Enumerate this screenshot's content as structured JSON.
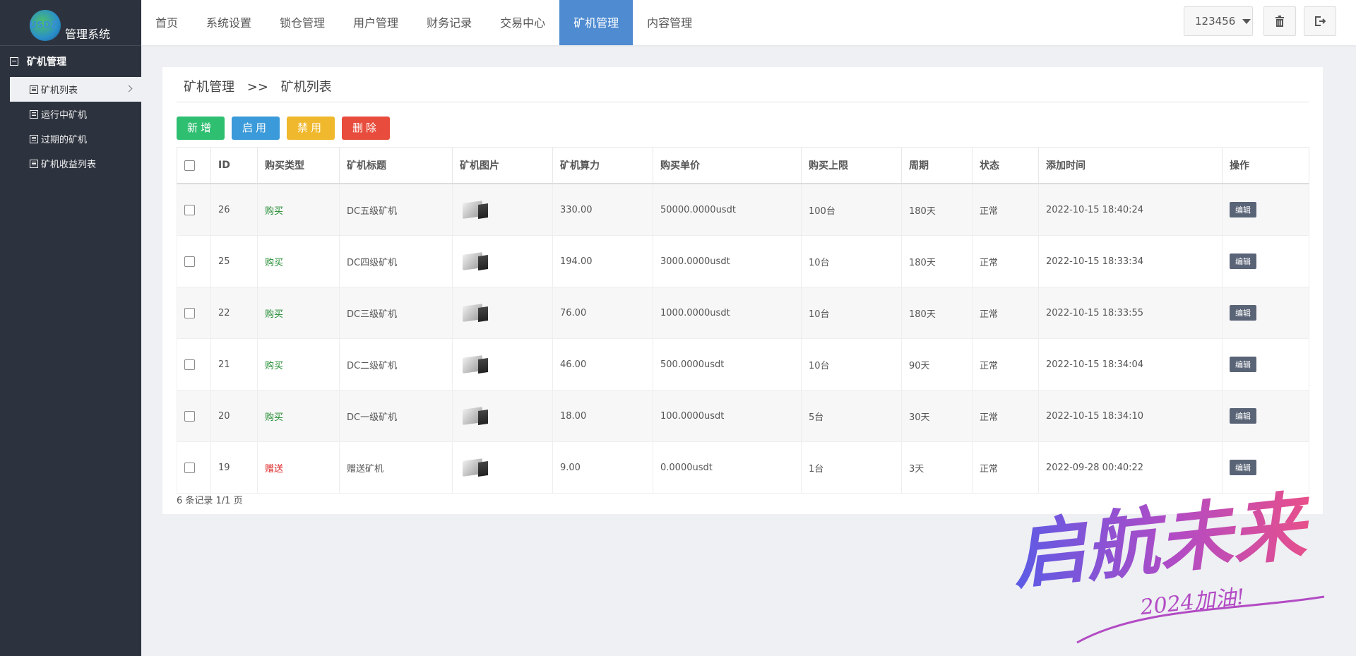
{
  "brand": {
    "logo_abbr": "USDZ",
    "name": "管理系统"
  },
  "sidebar": {
    "group": "矿机管理",
    "items": [
      {
        "label": "矿机列表",
        "active": true
      },
      {
        "label": "运行中矿机"
      },
      {
        "label": "过期的矿机"
      },
      {
        "label": "矿机收益列表"
      }
    ]
  },
  "nav": {
    "items": [
      "首页",
      "系统设置",
      "锁仓管理",
      "用户管理",
      "财务记录",
      "交易中心",
      "矿机管理",
      "内容管理"
    ],
    "active": "矿机管理",
    "user": "123456",
    "icons": [
      "trash-icon",
      "logout-icon"
    ]
  },
  "breadcrumb": {
    "parent": "矿机管理",
    "sep": ">>",
    "current": "矿机列表"
  },
  "toolbar": {
    "add": "新增",
    "enable": "启用",
    "disable": "禁用",
    "delete": "删除"
  },
  "table": {
    "headers": [
      "ID",
      "购买类型",
      "矿机标题",
      "矿机图片",
      "矿机算力",
      "购买单价",
      "购买上限",
      "周期",
      "状态",
      "添加时间",
      "操作"
    ],
    "rows": [
      {
        "id": "26",
        "type": "购买",
        "title": "DC五级矿机",
        "power": "330.00",
        "price": "50000.0000usdt",
        "limit": "100台",
        "period": "180天",
        "status": "正常",
        "time": "2022-10-15 18:40:24",
        "action": "编辑"
      },
      {
        "id": "25",
        "type": "购买",
        "title": "DC四级矿机",
        "power": "194.00",
        "price": "3000.0000usdt",
        "limit": "10台",
        "period": "180天",
        "status": "正常",
        "time": "2022-10-15 18:33:34",
        "action": "编辑"
      },
      {
        "id": "22",
        "type": "购买",
        "title": "DC三级矿机",
        "power": "76.00",
        "price": "1000.0000usdt",
        "limit": "10台",
        "period": "180天",
        "status": "正常",
        "time": "2022-10-15 18:33:55",
        "action": "编辑"
      },
      {
        "id": "21",
        "type": "购买",
        "title": "DC二级矿机",
        "power": "46.00",
        "price": "500.0000usdt",
        "limit": "10台",
        "period": "90天",
        "status": "正常",
        "time": "2022-10-15 18:34:04",
        "action": "编辑"
      },
      {
        "id": "20",
        "type": "购买",
        "title": "DC一级矿机",
        "power": "18.00",
        "price": "100.0000usdt",
        "limit": "5台",
        "period": "30天",
        "status": "正常",
        "time": "2022-10-15 18:34:10",
        "action": "编辑"
      },
      {
        "id": "19",
        "type": "赠送",
        "title": "赠送矿机",
        "power": "9.00",
        "price": "0.0000usdt",
        "limit": "1台",
        "period": "3天",
        "status": "正常",
        "time": "2022-09-28 00:40:22",
        "action": "编辑"
      }
    ]
  },
  "pager": {
    "text": "6 条记录 1/1 页"
  },
  "watermark": {
    "main": "启航未来",
    "sub": "2024加油!"
  },
  "colors": {
    "sidebar": "#2d333e",
    "nav_active": "#4e8bd1",
    "buy": "#1d8a2d",
    "gift": "#dd2222"
  }
}
